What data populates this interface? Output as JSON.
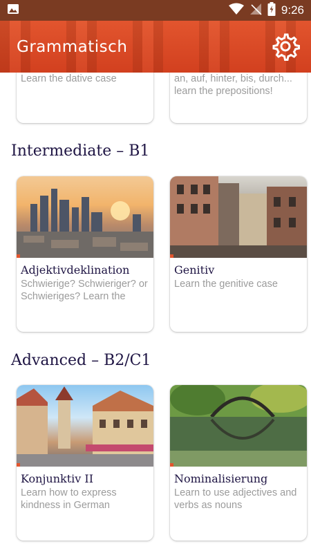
{
  "status_bar": {
    "time": "9:26"
  },
  "app_bar": {
    "title": "Grammatisch"
  },
  "top_row": [
    {
      "desc": "Learn the dative case"
    },
    {
      "desc": "an, auf, hinter, bis, durch... learn the prepositions!"
    }
  ],
  "sections": [
    {
      "title": "Intermediate – B1",
      "cards": [
        {
          "title": "Adjektivdeklination",
          "desc": "Schwierige? Schwieriger? or Schwieriges? Learn the",
          "image": "city-skyline-sunset"
        },
        {
          "title": "Genitiv",
          "desc": "Learn the genitive case",
          "image": "old-town-street"
        }
      ]
    },
    {
      "title": "Advanced – B2/C1",
      "cards": [
        {
          "title": "Konjunktiv II",
          "desc": "Learn how to express kindness in German",
          "image": "medieval-town-tower"
        },
        {
          "title": "Nominalisierung",
          "desc": "Learn to use adjectives and verbs as nouns",
          "image": "stone-arch-bridge-lake"
        }
      ]
    }
  ],
  "colors": {
    "status_bar": "#7a3b22",
    "app_bar": "#d94a27",
    "accent": "#e2552e",
    "heading": "#1e1443",
    "desc": "#9b9b9b"
  }
}
